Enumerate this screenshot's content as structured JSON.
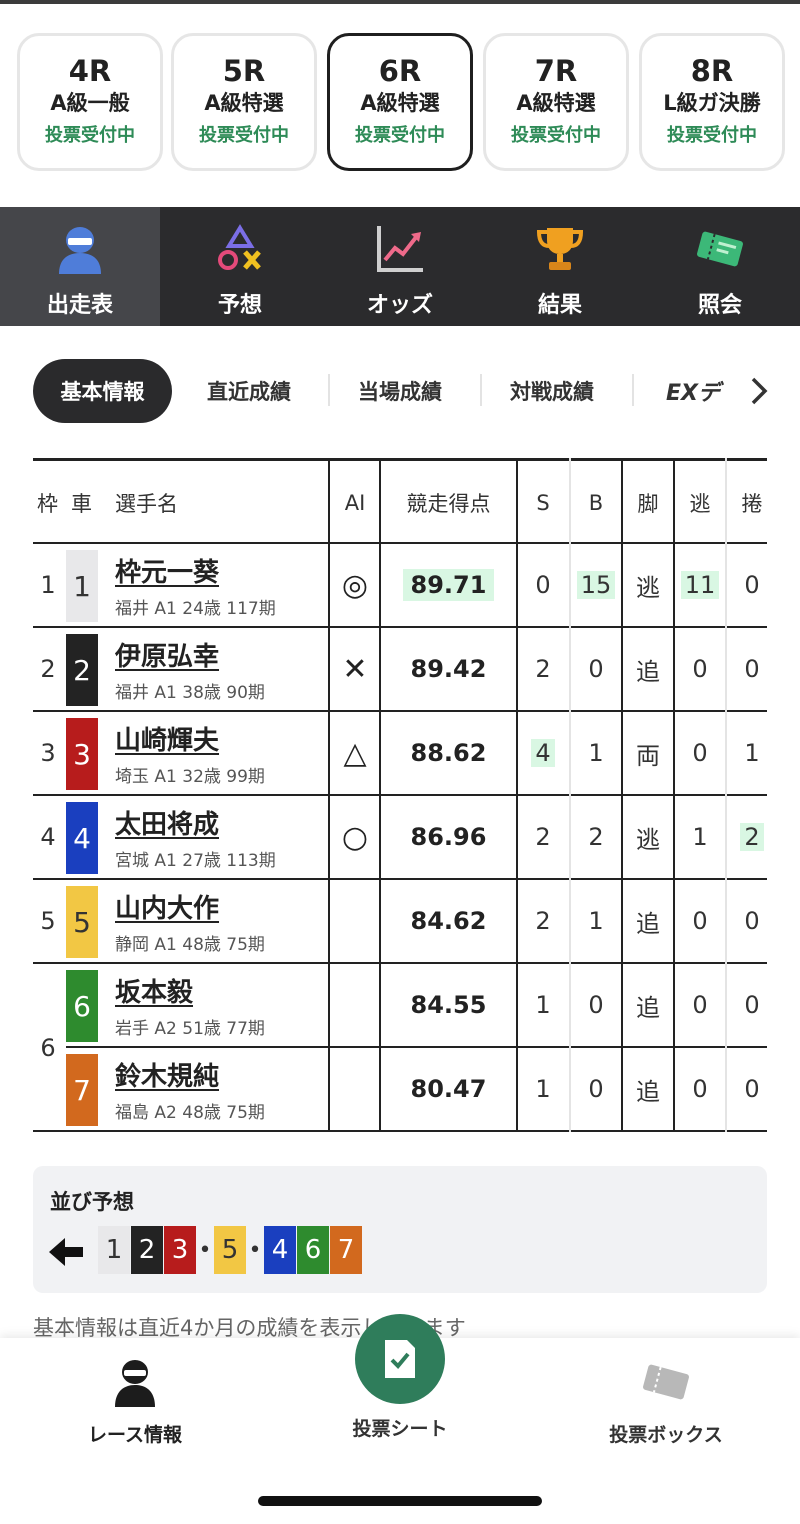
{
  "races": [
    {
      "no": "4R",
      "cls": "A級一般",
      "status": "投票受付中"
    },
    {
      "no": "5R",
      "cls": "A級特選",
      "status": "投票受付中"
    },
    {
      "no": "6R",
      "cls": "A級特選",
      "status": "投票受付中"
    },
    {
      "no": "7R",
      "cls": "A級特選",
      "status": "投票受付中"
    },
    {
      "no": "8R",
      "cls": "L級ガ決勝",
      "status": "投票受付中"
    }
  ],
  "active_race": "6R",
  "main_nav": [
    "出走表",
    "予想",
    "オッズ",
    "結果",
    "照会"
  ],
  "sub_tabs": {
    "active": "基本情報",
    "tabs": [
      "直近成績",
      "当場成績",
      "対戦成績"
    ],
    "ex": "EXデ"
  },
  "table": {
    "headers": {
      "waku": "枠",
      "car": "車",
      "name": "選手名",
      "ai": "AI",
      "score": "競走得点",
      "s": "S",
      "b": "B",
      "kyaku": "脚",
      "nige": "逃",
      "makuri": "捲"
    },
    "rows": [
      {
        "waku": "1",
        "car": "1",
        "name": "枠元一葵",
        "info": "福井 A1 24歳 117期",
        "ai": "◎",
        "score": "89.71",
        "s": "0",
        "b": "15",
        "kyaku": "逃",
        "nige": "11",
        "makuri": "0"
      },
      {
        "waku": "2",
        "car": "2",
        "name": "伊原弘幸",
        "info": "福井 A1 38歳 90期",
        "ai": "✕",
        "score": "89.42",
        "s": "2",
        "b": "0",
        "kyaku": "追",
        "nige": "0",
        "makuri": "0"
      },
      {
        "waku": "3",
        "car": "3",
        "name": "山崎輝夫",
        "info": "埼玉 A1 32歳 99期",
        "ai": "△",
        "score": "88.62",
        "s": "4",
        "b": "1",
        "kyaku": "両",
        "nige": "0",
        "makuri": "1"
      },
      {
        "waku": "4",
        "car": "4",
        "name": "太田将成",
        "info": "宮城 A1 27歳 113期",
        "ai": "○",
        "score": "86.96",
        "s": "2",
        "b": "2",
        "kyaku": "逃",
        "nige": "1",
        "makuri": "2"
      },
      {
        "waku": "5",
        "car": "5",
        "name": "山内大作",
        "info": "静岡 A1 48歳 75期",
        "ai": "",
        "score": "84.62",
        "s": "2",
        "b": "1",
        "kyaku": "追",
        "nige": "0",
        "makuri": "0"
      },
      {
        "waku": "6",
        "car": "6",
        "name": "坂本毅",
        "info": "岩手 A2 51歳 77期",
        "ai": "",
        "score": "84.55",
        "s": "1",
        "b": "0",
        "kyaku": "追",
        "nige": "0",
        "makuri": "0"
      },
      {
        "waku": "",
        "car": "7",
        "name": "鈴木規純",
        "info": "福島 A2 48歳 75期",
        "ai": "",
        "score": "80.47",
        "s": "1",
        "b": "0",
        "kyaku": "追",
        "nige": "0",
        "makuri": "0"
      }
    ]
  },
  "car_colors": {
    "1": "#e8e8ea",
    "2": "#232323",
    "3": "#b71c1c",
    "4": "#1a3fbf",
    "5": "#f2c744",
    "6": "#2e8b2e",
    "7": "#d2691e"
  },
  "narabi": {
    "title": "並び予想",
    "groups": [
      [
        "1",
        "2",
        "3"
      ],
      [
        "5"
      ],
      [
        "4",
        "6",
        "7"
      ]
    ]
  },
  "note": "基本情報は直近4か月の成績を表示しています",
  "bottom_nav": [
    "レース情報",
    "投票シート",
    "投票ボックス"
  ]
}
